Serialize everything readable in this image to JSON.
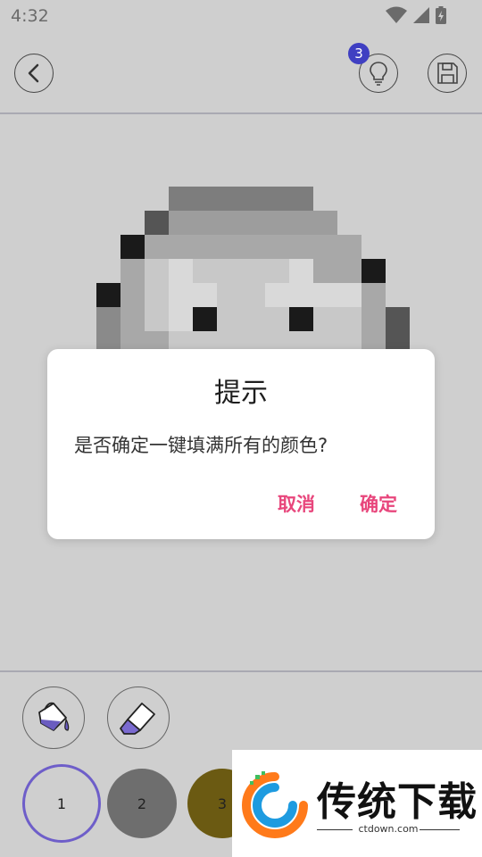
{
  "status_bar": {
    "time": "4:32"
  },
  "toolbar": {
    "hint_count": "3"
  },
  "dialog": {
    "title": "提示",
    "message": "是否确定一键填满所有的颜色?",
    "cancel_label": "取消",
    "ok_label": "确定"
  },
  "palette": {
    "swatches": [
      {
        "label": "1",
        "color": "#ffffff"
      },
      {
        "label": "2",
        "color": "#6e6e6e"
      },
      {
        "label": "3",
        "color": "#6b5a12"
      }
    ]
  },
  "watermark": {
    "brand": "传统下载",
    "url": "ctdown.com"
  },
  "colors": {
    "accent": "#e8467c",
    "badge": "#3f3fc2",
    "selected_ring": "#6e5ec9"
  }
}
